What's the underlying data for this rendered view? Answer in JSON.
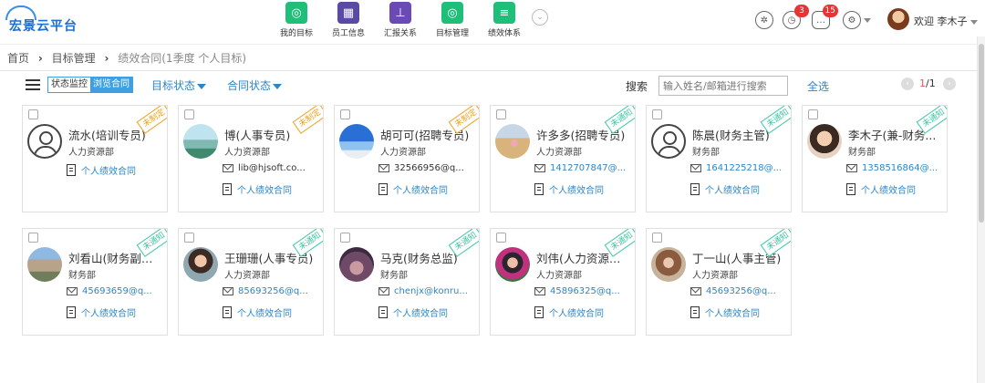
{
  "brand": {
    "name": "宏景云平台"
  },
  "nav": {
    "items": [
      {
        "label": "我的目标",
        "icon": "target-icon",
        "color": "#1fbf7a",
        "glyph": "◎"
      },
      {
        "label": "员工信息",
        "icon": "id-card-icon",
        "color": "#5a4aa3",
        "glyph": "▦"
      },
      {
        "label": "汇报关系",
        "icon": "org-chart-icon",
        "color": "#6a4bb5",
        "glyph": "⊥"
      },
      {
        "label": "目标管理",
        "icon": "target-manage-icon",
        "color": "#1fbf7a",
        "glyph": "◎"
      },
      {
        "label": "绩效体系",
        "icon": "performance-icon",
        "color": "#1fbf7a",
        "glyph": "≡"
      }
    ]
  },
  "toolbar": {
    "clock_badge": "3",
    "message_badge": "15",
    "welcome": "欢迎 李木子"
  },
  "breadcrumb": {
    "items": [
      "首页",
      "目标管理",
      "绩效合同(1季度 个人目标)"
    ]
  },
  "filter": {
    "segment_off": "状态监控",
    "segment_on": "浏览合同",
    "target_status": "目标状态",
    "contract_status": "合同状态",
    "search_label": "搜索",
    "search_placeholder": "输入姓名/邮箱进行搜索",
    "select_all": "全选",
    "page_current": "1",
    "page_total": "/1"
  },
  "cards": [
    {
      "name": "流水(培训专员)",
      "dept": "人力资源部",
      "email": "",
      "contract": "个人绩效合同",
      "status": "未制定",
      "status_type": "pending",
      "photo": "default"
    },
    {
      "name": "博(人事专员)",
      "dept": "人力资源部",
      "email": "lib@hjsoft.co...",
      "contract": "个人绩效合同",
      "status": "未制定",
      "status_type": "pending",
      "photo": "sea",
      "email_dark": true
    },
    {
      "name": "胡可可(招聘专员)",
      "dept": "人力资源部",
      "email": "32566956@q...",
      "contract": "个人绩效合同",
      "status": "未制定",
      "status_type": "pending",
      "photo": "sky",
      "email_dark": true
    },
    {
      "name": "许多多(招聘专员)",
      "dept": "人力资源部",
      "email": "1412707847@...",
      "contract": "个人绩效合同",
      "status": "未通知",
      "status_type": "unnotified",
      "photo": "desert"
    },
    {
      "name": "陈晨(财务主管)",
      "dept": "财务部",
      "email": "1641225218@...",
      "contract": "个人绩效合同",
      "status": "未通知",
      "status_type": "unnotified",
      "photo": "default"
    },
    {
      "name": "李木子(兼-财务...",
      "dept": "财务部",
      "email": "1358516864@...",
      "contract": "个人绩效合同",
      "status": "未通知",
      "status_type": "unnotified",
      "photo": "girl"
    },
    {
      "name": "刘看山(财务副总...",
      "dept": "财务部",
      "email": "45693659@q...",
      "contract": "个人绩效合同",
      "status": "未通知",
      "status_type": "unnotified",
      "photo": "mountain"
    },
    {
      "name": "王珊珊(人事专员)",
      "dept": "人力资源部",
      "email": "85693256@q...",
      "contract": "个人绩效合同",
      "status": "未通知",
      "status_type": "unnotified",
      "photo": "portrait"
    },
    {
      "name": "马克(财务总监)",
      "dept": "财务部",
      "email": "chenjx@konru...",
      "contract": "个人绩效合同",
      "status": "未通知",
      "status_type": "unnotified",
      "photo": "dusk"
    },
    {
      "name": "刘伟(人力资源部...",
      "dept": "人力资源部",
      "email": "45896325@q...",
      "contract": "个人绩效合同",
      "status": "未通知",
      "status_type": "unnotified",
      "photo": "flower"
    },
    {
      "name": "丁一山(人事主管)",
      "dept": "人力资源部",
      "email": "45693256@q...",
      "contract": "个人绩效合同",
      "status": "未通知",
      "status_type": "unnotified",
      "photo": "room"
    }
  ]
}
